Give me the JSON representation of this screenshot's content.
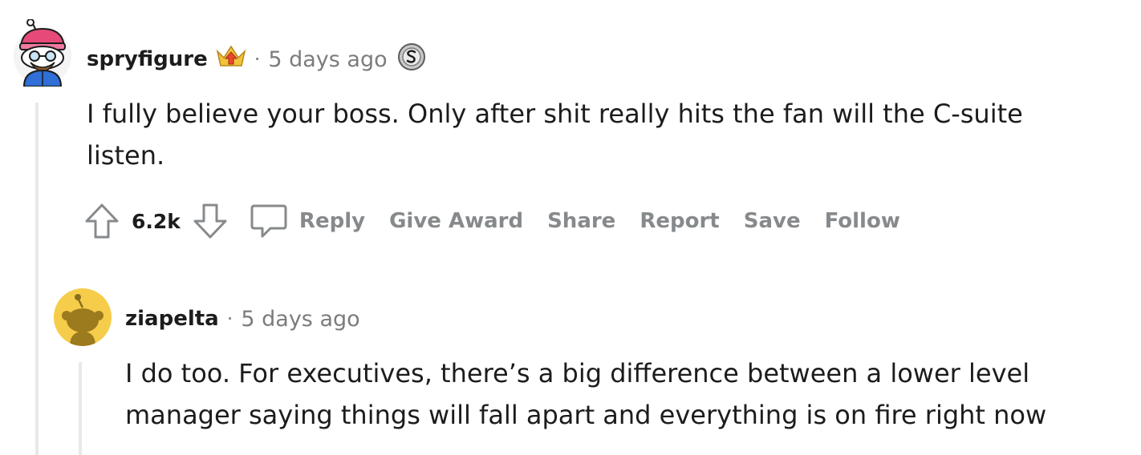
{
  "comments": [
    {
      "username": "spryfigure",
      "separator": "·",
      "timestamp": "5 days ago",
      "badge_icon": "flair-upvote-badge-icon",
      "award_icon": "silver-award-icon",
      "body": "I fully believe your boss. Only after shit really hits the fan will the C-suite listen.",
      "score": "6.2k",
      "actions": {
        "reply": "Reply",
        "give_award": "Give Award",
        "share": "Share",
        "report": "Report",
        "save": "Save",
        "follow": "Follow"
      }
    },
    {
      "username": "ziapelta",
      "separator": "·",
      "timestamp": "5 days ago",
      "body": "I do too. For executives, there’s a big difference between a lower level manager saying things will fall apart and everything is on fire right now"
    }
  ],
  "colors": {
    "text_primary": "#1c1c1c",
    "text_muted": "#878a8c",
    "thread_line": "#e8e8e8",
    "default_avatar_bg": "#f6cd4a"
  }
}
